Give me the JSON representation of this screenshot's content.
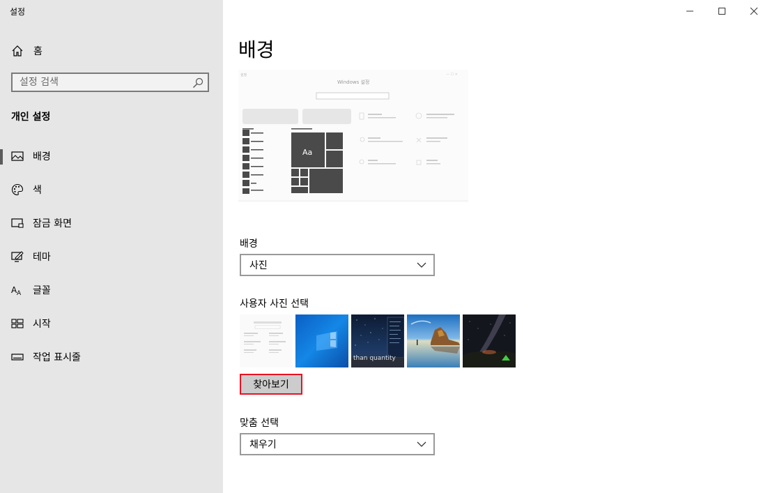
{
  "window": {
    "title": "설정",
    "minimize_icon": "minimize-icon",
    "maximize_icon": "maximize-icon",
    "close_icon": "close-icon"
  },
  "sidebar": {
    "home_label": "홈",
    "search_placeholder": "설정 검색",
    "section_title": "개인 설정",
    "items": [
      {
        "label": "배경",
        "icon": "picture-icon",
        "selected": true
      },
      {
        "label": "색",
        "icon": "palette-icon",
        "selected": false
      },
      {
        "label": "잠금 화면",
        "icon": "lock-screen-icon",
        "selected": false
      },
      {
        "label": "테마",
        "icon": "theme-icon",
        "selected": false
      },
      {
        "label": "글꼴",
        "icon": "font-icon",
        "selected": false
      },
      {
        "label": "시작",
        "icon": "start-icon",
        "selected": false
      },
      {
        "label": "작업 표시줄",
        "icon": "taskbar-icon",
        "selected": false
      }
    ]
  },
  "main": {
    "title": "배경",
    "preview": {
      "window_title": "Windows 설정",
      "tile_label": "Aa"
    },
    "background": {
      "label": "배경",
      "value": "사진"
    },
    "choose_picture": {
      "label": "사용자 사진 선택",
      "thumbnails": [
        {
          "name": "settings-screenshot",
          "caption": ""
        },
        {
          "name": "windows-blue",
          "caption": ""
        },
        {
          "name": "starry-night-screen",
          "caption": "than quantity"
        },
        {
          "name": "beach-rock",
          "caption": ""
        },
        {
          "name": "milky-way-tent",
          "caption": ""
        }
      ],
      "browse_label": "찾아보기"
    },
    "fit": {
      "label": "맞춤 선택",
      "value": "채우기"
    }
  },
  "colors": {
    "sidebar_bg": "#e6e6e6",
    "accent_red": "#e81123",
    "windows_blue": "#0a78d7"
  }
}
